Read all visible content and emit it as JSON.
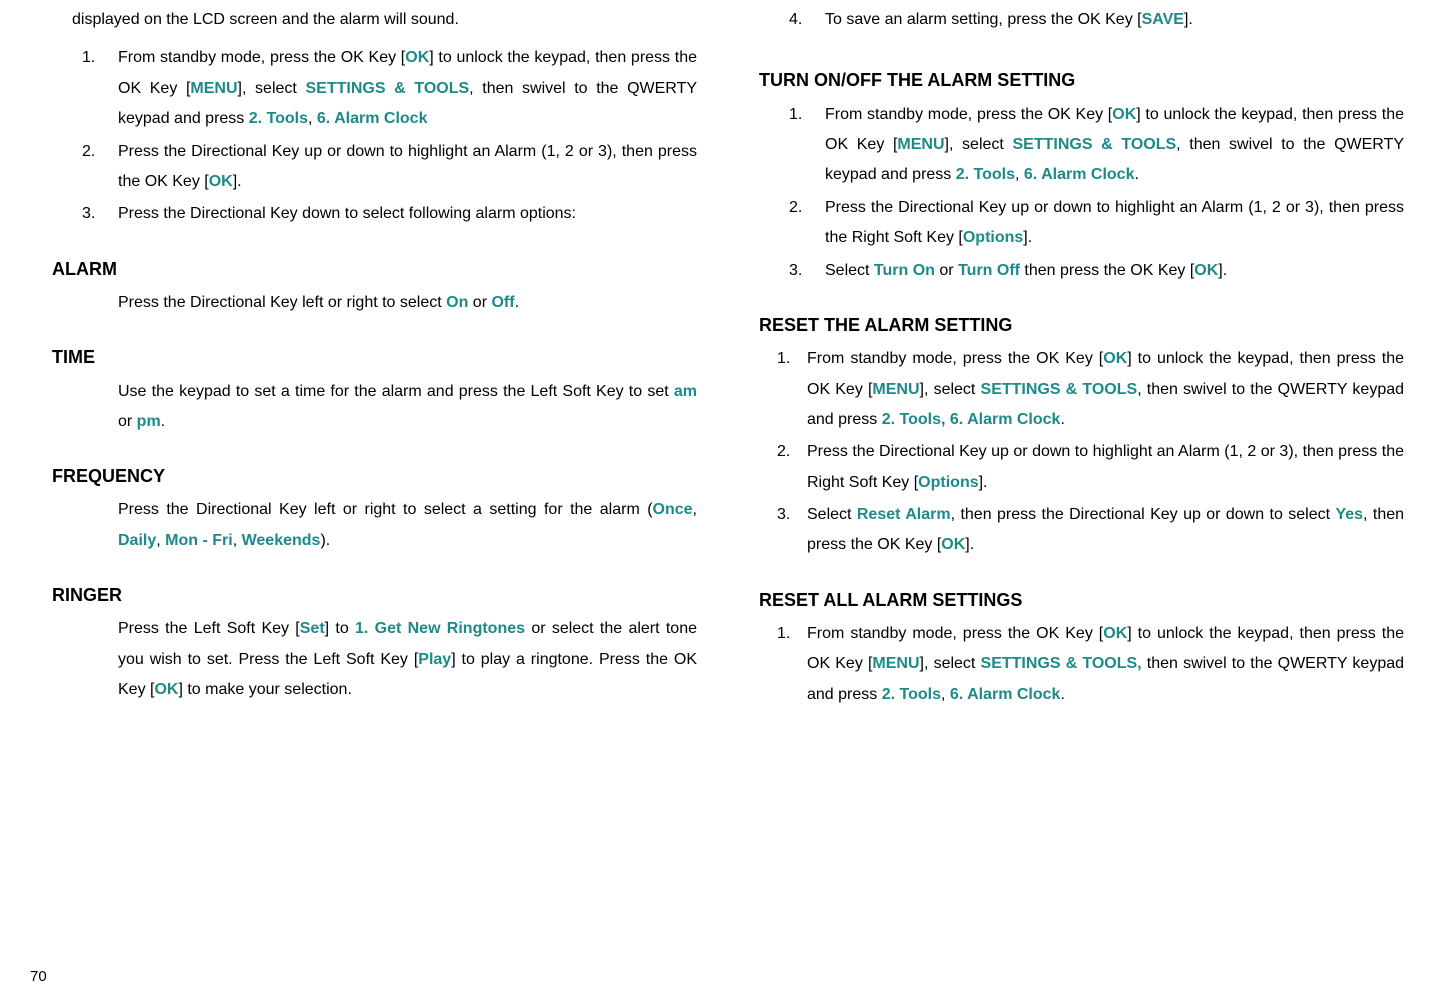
{
  "left": {
    "intro": "displayed on the LCD screen and the alarm will sound.",
    "steps": {
      "s1_a": "From standby mode, press the OK Key [",
      "s1_ok": "OK",
      "s1_b": "] to unlock the keypad, then press the OK Key [",
      "s1_menu": "MENU",
      "s1_c": "], select ",
      "s1_settings": "SETTINGS & TOOLS",
      "s1_d": ", then swivel to the QWERTY keypad and press ",
      "s1_tools": "2. Tools",
      "s1_e": ", ",
      "s1_alarm": "6. Alarm Clock",
      "s2_a": "Press the Directional Key up or down to highlight an Alarm (1, 2 or 3), then press the OK Key [",
      "s2_ok": "OK",
      "s2_b": "].",
      "s3": "Press the Directional Key down to select following alarm options:"
    },
    "alarm": {
      "heading": "ALARM",
      "body_a": "Press the Directional Key left or right to select ",
      "on": "On",
      "or": " or ",
      "off": "Off",
      "body_b": "."
    },
    "time": {
      "heading": "TIME",
      "body_a": "Use the keypad to set a time for the alarm and press the Left Soft Key to set ",
      "am": "am",
      "or": " or ",
      "pm": "pm",
      "body_b": "."
    },
    "frequency": {
      "heading": "FREQUENCY",
      "body_a": "Press the Directional Key left or right to select a setting for the alarm (",
      "once": "Once",
      "c1": ", ",
      "daily": "Daily",
      "c2": ", ",
      "monfri": "Mon - Fri",
      "c3": ", ",
      "weekends": "Weekends",
      "body_b": ")."
    },
    "ringer": {
      "heading": "RINGER",
      "body_a": "Press the Left Soft Key [",
      "set": "Set",
      "body_b": "] to ",
      "getnew": "1. Get New Ringtones",
      "body_c": " or select the alert tone you wish to set. Press the Left Soft Key [",
      "play": "Play",
      "body_d": "] to play a ringtone. Press the OK Key [",
      "ok": "OK",
      "body_e": "] to make your selection."
    }
  },
  "right": {
    "save": {
      "num": "4.",
      "a": "To save an alarm setting, press the OK Key [",
      "save_key": "SAVE",
      "b": "]."
    },
    "turn": {
      "heading": "TURN ON/OFF THE ALARM SETTING",
      "s1_a": "From standby mode, press the OK Key [",
      "s1_ok": "OK",
      "s1_b": "] to unlock the keypad, then press the OK Key [",
      "s1_menu": "MENU",
      "s1_c": "], select ",
      "s1_settings": "SETTINGS & TOOLS",
      "s1_d": ", then swivel to the QWERTY keypad and press ",
      "s1_tools": "2. Tools",
      "s1_e": ", ",
      "s1_alarm": "6. Alarm Clock",
      "s1_f": ".",
      "s2_a": "Press the Directional Key up or down to highlight an Alarm (1, 2 or 3), then press the Right Soft Key [",
      "s2_options": "Options",
      "s2_b": "].",
      "s3_a": "Select ",
      "s3_on": "Turn On",
      "s3_or": " or ",
      "s3_off": "Turn Off",
      "s3_b": " then press the OK Key [",
      "s3_ok": "OK",
      "s3_c": "]."
    },
    "reset": {
      "heading": "RESET THE ALARM SETTING",
      "s1_a": "From standby mode, press the OK Key [",
      "s1_ok": "OK",
      "s1_b": "] to unlock the keypad, then press the OK Key [",
      "s1_menu": "MENU",
      "s1_c": "], select ",
      "s1_settings": "SETTINGS & TOOLS",
      "s1_d": ", then swivel to the QWERTY keypad and press ",
      "s1_tools": "2. Tools, 6. Alarm Clock",
      "s1_e": ".",
      "s2_a": "Press the Directional Key up or down to highlight an Alarm (1, 2 or 3), then press the Right Soft Key [",
      "s2_options": "Options",
      "s2_b": "].",
      "s3_a": "Select ",
      "s3_reset": "Reset Alarm",
      "s3_b": ", then press the Directional Key up or down to select ",
      "s3_yes": "Yes",
      "s3_c": ", then press the OK Key [",
      "s3_ok": "OK",
      "s3_d": "]."
    },
    "resetall": {
      "heading": "RESET ALL ALARM SETTINGS",
      "s1_a": "From standby mode, press the OK Key [",
      "s1_ok": "OK",
      "s1_b": "] to unlock the keypad, then press the OK Key [",
      "s1_menu": "MENU",
      "s1_c": "], select ",
      "s1_settings": "SETTINGS & TOOLS,",
      "s1_d": " then swivel to the QWERTY keypad and press ",
      "s1_tools": "2. Tools",
      "s1_e": ", ",
      "s1_alarm": "6. Alarm Clock",
      "s1_f": "."
    }
  },
  "page_number": "70",
  "nums": {
    "n1": "1.",
    "n2": "2.",
    "n3": "3.",
    "n4": "4."
  }
}
